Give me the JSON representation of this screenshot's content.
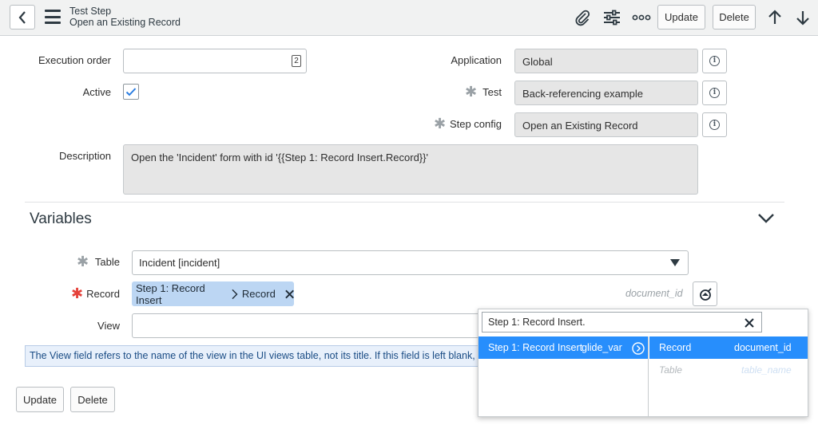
{
  "header": {
    "title": "Test Step",
    "subtitle": "Open an Existing Record",
    "update_label": "Update",
    "delete_label": "Delete"
  },
  "form": {
    "execution_order_label": "Execution order",
    "execution_order_value": "",
    "active_label": "Active",
    "active_checked": true,
    "application_label": "Application",
    "application_value": "Global",
    "test_label": "Test",
    "test_value": "Back-referencing example",
    "step_config_label": "Step config",
    "step_config_value": "Open an Existing Record",
    "description_label": "Description",
    "description_value": "Open the 'Incident' form with id '{{Step 1: Record Insert.Record}}'"
  },
  "variables": {
    "title": "Variables",
    "table_label": "Table",
    "table_value": "Incident [incident]",
    "record_label": "Record",
    "record_pill_step": "Step 1: Record Insert",
    "record_pill_field": "Record",
    "record_type": "document_id",
    "view_label": "View",
    "view_value": "",
    "view_note": "The View field refers to the name of the view in the UI views table, not its title. If this field is left blank, the"
  },
  "footer": {
    "update_label": "Update",
    "delete_label": "Delete"
  },
  "picker": {
    "search_value": "Step 1: Record Insert.",
    "left_item_name": "Step 1: Record Insert",
    "left_item_type": "glide_var",
    "right_items": [
      {
        "name": "Record",
        "type": "document_id"
      },
      {
        "name": "Table",
        "type": "table_name"
      }
    ]
  },
  "colors": {
    "header_bg": "#f1f2f2",
    "selected_row": "#278efc",
    "pill_bg": "#bcd6f3",
    "required_star": "#e5413a"
  }
}
